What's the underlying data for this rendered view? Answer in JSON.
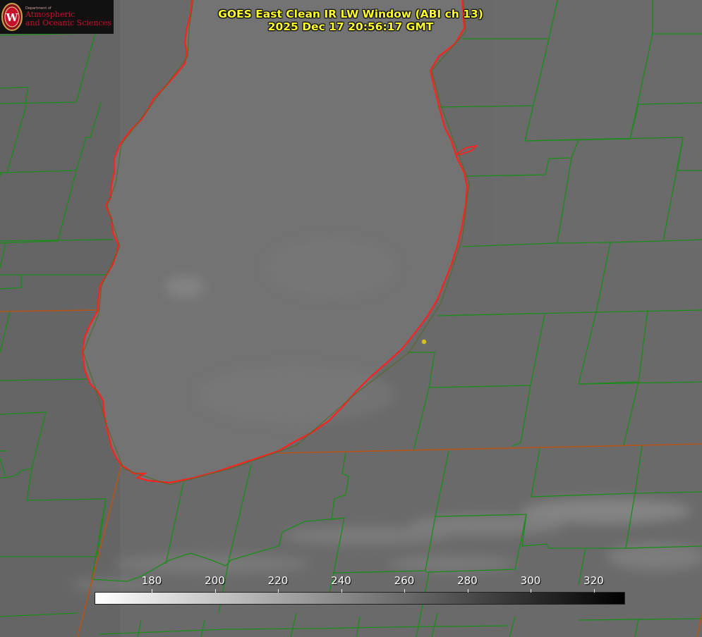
{
  "title": {
    "line1": "GOES East Clean IR LW Window (ABI ch 13)",
    "line2": "2025 Dec 17 20:56:17 GMT"
  },
  "logo": {
    "dept": "Department of",
    "line1": "Atmospheric",
    "line2": "and Oceanic Sciences"
  },
  "colorbar": {
    "ticks": [
      "180",
      "200",
      "220",
      "240",
      "260",
      "280",
      "300",
      "320"
    ],
    "colors": {
      "low": "#ffffff",
      "high": "#000000"
    }
  },
  "colors": {
    "lake_outline": "#ff2020",
    "county_lines": "#1a8c1a",
    "state_lines": "#b5541a",
    "marker": "#d4c21a",
    "title_text": "#ffff2a"
  }
}
